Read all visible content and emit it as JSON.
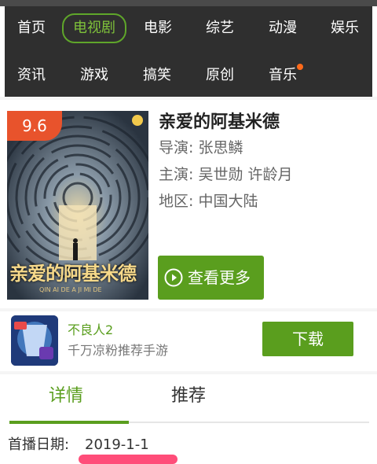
{
  "nav": {
    "row1": [
      "首页",
      "电视剧",
      "电影",
      "综艺",
      "动漫",
      "娱乐"
    ],
    "row2": [
      "资讯",
      "游戏",
      "搞笑",
      "原创",
      "音乐"
    ],
    "active_index": 1,
    "badge_on": "音乐"
  },
  "show": {
    "rating": "9.6",
    "title": "亲爱的阿基米德",
    "director": "导演: 张思鳞",
    "cast": "主演: 吴世勋 许龄月",
    "region": "地区: 中国大陆",
    "poster_title": "亲爱的阿基米德",
    "poster_subtitle": "QIN AI DE A JI MI DE",
    "more_button": "查看更多"
  },
  "ad": {
    "name": "不良人2",
    "description": "千万凉粉推荐手游",
    "download_button": "下载"
  },
  "tabs": [
    "详情",
    "推荐"
  ],
  "detail": {
    "premiere_label": "首播日期:",
    "premiere_date": "2019-1-1"
  },
  "colors": {
    "accent": "#5a9e1e",
    "nav_bg": "#2f2f2f",
    "rating_bg": "#e8532c",
    "badge": "#ff6a1a"
  }
}
